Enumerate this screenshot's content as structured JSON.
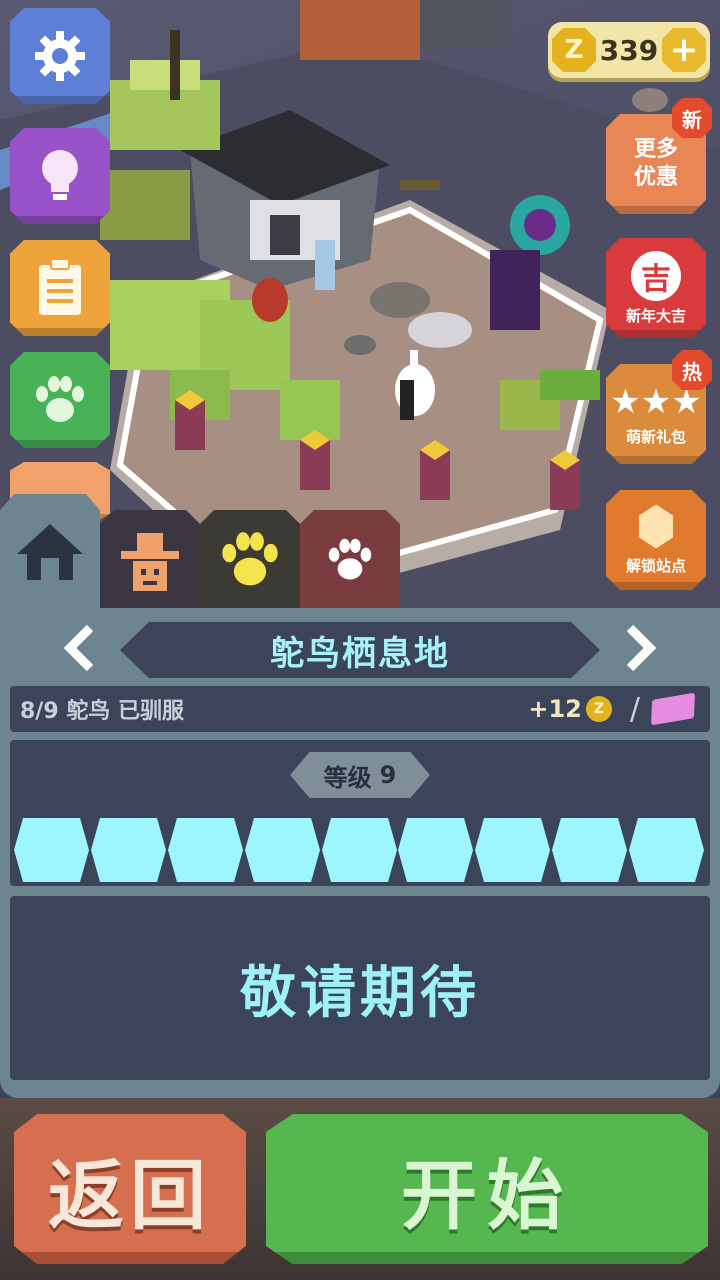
{
  "currency": {
    "amount": "339",
    "coin_symbol": "Z",
    "plus": "+"
  },
  "menu": {
    "settings": "gear-icon",
    "tips": "lightbulb-icon",
    "tasks": "clipboard-icon",
    "animals": "paw-icon"
  },
  "promos": {
    "more_deals": {
      "label": "更多优惠",
      "badge": "新"
    },
    "new_year": {
      "label": "新年大吉",
      "emblem": "吉"
    },
    "cute_pack": {
      "label": "萌新礼包",
      "badge": "热"
    },
    "unlock": {
      "label": "解锁站点"
    }
  },
  "tabs": [
    "home-icon",
    "cowboy-icon",
    "paw-icon",
    "paw-icon"
  ],
  "habitat": {
    "title": "鸵鸟栖息地",
    "tamed_text": "8/9 鸵鸟 已驯服",
    "reward": "+12",
    "slash": "/",
    "level_label": "等级",
    "level_value": "9",
    "progress": {
      "filled": 9,
      "total": 9
    },
    "coming_soon": "敬请期待"
  },
  "buttons": {
    "back": "返回",
    "start": "开始"
  },
  "colors": {
    "accent_cyan": "#9df6fd",
    "panel": "#6d8591",
    "panel_dark": "#3c4459",
    "back": "#d66f4f",
    "start": "#56b650"
  }
}
